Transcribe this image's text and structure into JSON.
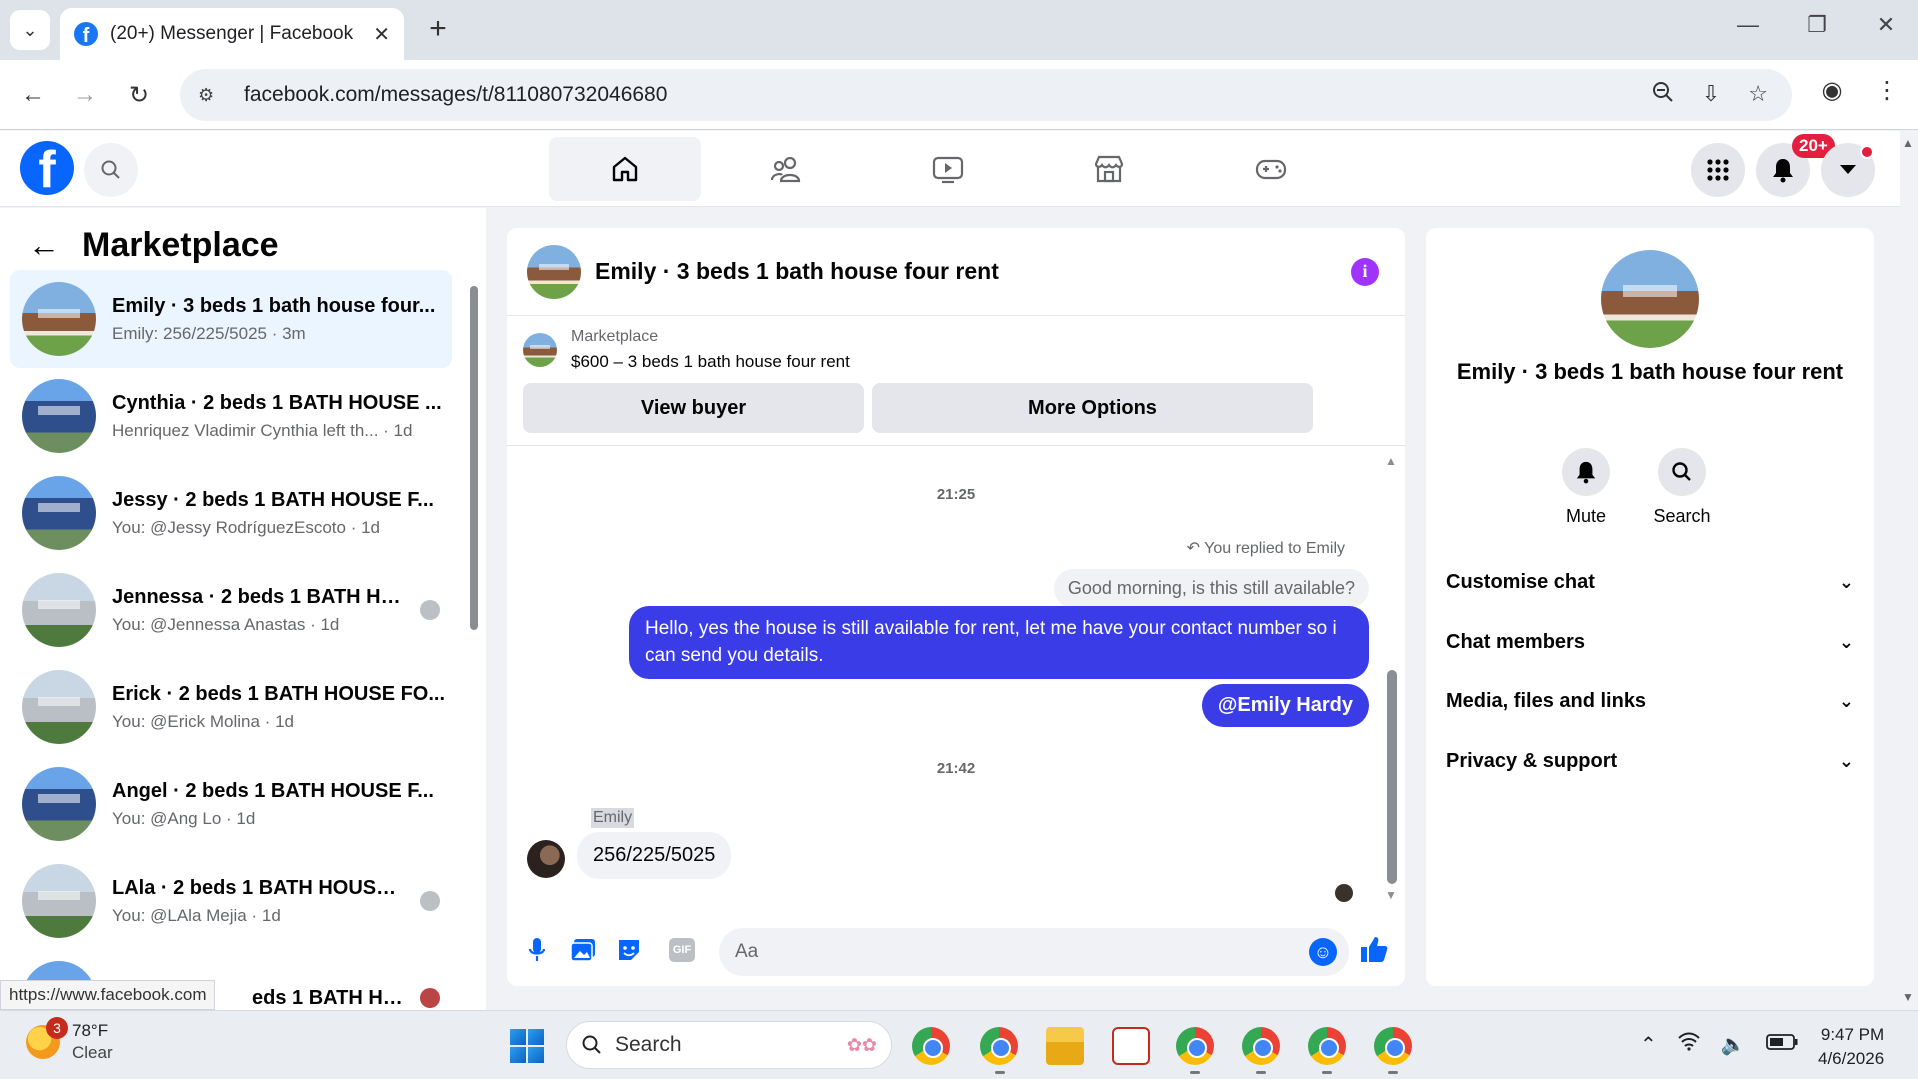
{
  "browser": {
    "tab_title": "(20+) Messenger | Facebook",
    "url": "facebook.com/messages/t/811080732046680",
    "status_url": "https://www.facebook.com"
  },
  "fb": {
    "logo_letter": "f",
    "notification_badge": "20+"
  },
  "left": {
    "title": "Marketplace",
    "conversations": [
      {
        "name": "Emily · 3 beds 1 bath house four...",
        "sub": "Emily: 256/225/5025 · 3m",
        "style": "brick"
      },
      {
        "name": "Cynthia · 2 beds 1 BATH HOUSE ...",
        "sub": "Henriquez Vladimir Cynthia left th... · 1d",
        "style": "blue"
      },
      {
        "name": "Jessy · 2 beds 1 BATH HOUSE F...",
        "sub": "You: @Jessy RodríguezEscoto · 1d",
        "style": "blue"
      },
      {
        "name": "Jennessa · 2 beds 1 BATH HO...",
        "sub": "You: @Jennessa Anastas · 1d",
        "style": "grey"
      },
      {
        "name": "Erick · 2 beds 1 BATH HOUSE FO...",
        "sub": "You: @Erick Molina · 1d",
        "style": "grey"
      },
      {
        "name": "Angel · 2 beds 1 BATH HOUSE F...",
        "sub": "You: @Ang Lo · 1d",
        "style": "blue"
      },
      {
        "name": "LAla · 2 beds 1 BATH HOUSE F...",
        "sub": "You: @LAla Mejia · 1d",
        "style": "grey"
      },
      {
        "name": "eds 1 BATH HOU...",
        "sub": "",
        "style": "blue"
      }
    ]
  },
  "chat": {
    "title": "Emily · 3 beds 1 bath house four rent",
    "marketplace_label": "Marketplace",
    "listing": "$600 – 3 beds 1 bath house four rent",
    "view_buyer": "View buyer",
    "more_options": "More Options",
    "time1": "21:25",
    "reply_note": "You replied to Emily",
    "quoted": "Good morning, is this still available?",
    "sent_message": "Hello, yes the house is still available for rent, let me have your contact number so i can send you details.",
    "mention": "@Emily Hardy",
    "time2": "21:42",
    "sender": "Emily",
    "received": "256/225/5025",
    "input_placeholder": "Aa",
    "gif_label": "GIF"
  },
  "right": {
    "title": "Emily · 3 beds 1 bath house four rent",
    "mute": "Mute",
    "search": "Search",
    "sections": [
      "Customise chat",
      "Chat members",
      "Media, files and links",
      "Privacy & support"
    ]
  },
  "taskbar": {
    "weather_temp": "78°F",
    "weather_cond": "Clear",
    "weather_badge": "3",
    "search": "Search",
    "time": "9:47 PM",
    "date": "4/6/2026"
  }
}
